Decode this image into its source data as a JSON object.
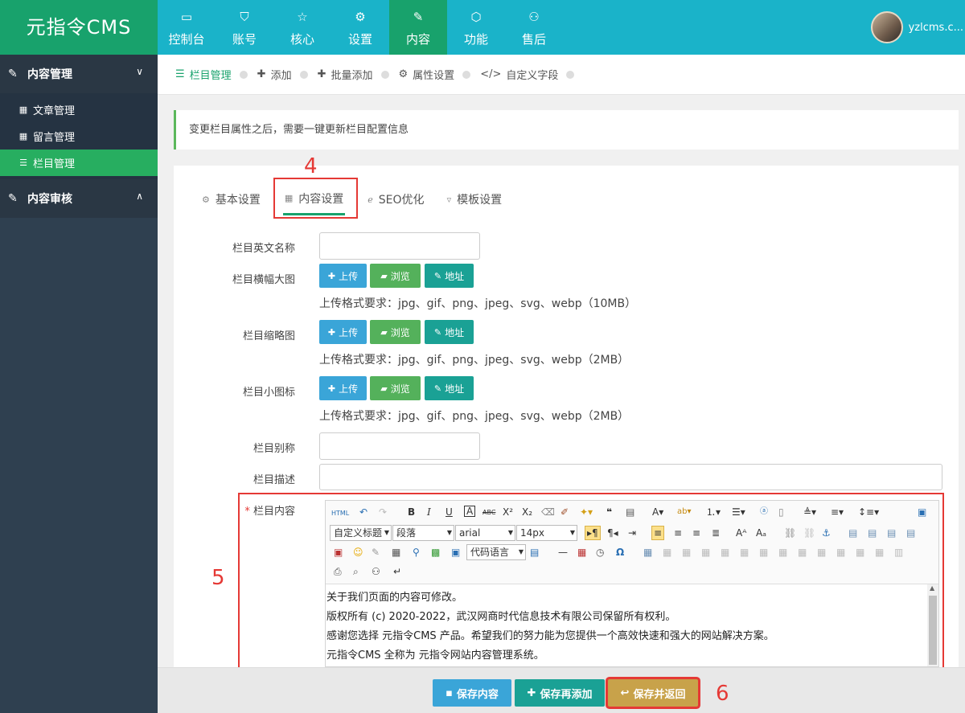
{
  "app": {
    "logo": "元指令CMS"
  },
  "nav": [
    {
      "label": "控制台",
      "icon": "monitor-icon",
      "glyph": "▭"
    },
    {
      "label": "账号",
      "icon": "shield-icon",
      "glyph": "⛉"
    },
    {
      "label": "核心",
      "icon": "star-icon",
      "glyph": "☆"
    },
    {
      "label": "设置",
      "icon": "gear-icon",
      "glyph": "⚙"
    },
    {
      "label": "内容",
      "icon": "edit-icon",
      "glyph": "✎"
    },
    {
      "label": "功能",
      "icon": "cube-icon",
      "glyph": "⬡"
    },
    {
      "label": "售后",
      "icon": "user-plus-icon",
      "glyph": "⚇"
    }
  ],
  "user": {
    "name": "yzlcms.c..."
  },
  "sidebar": {
    "section1": {
      "label": "内容管理",
      "chevron": "∨"
    },
    "items": [
      {
        "label": "文章管理",
        "glyph": "▦"
      },
      {
        "label": "留言管理",
        "glyph": "▦"
      },
      {
        "label": "栏目管理",
        "glyph": "☰"
      }
    ],
    "section2": {
      "label": "内容审核",
      "chevron": "∧"
    }
  },
  "crumbs": [
    {
      "label": "栏目管理",
      "glyph": "☰"
    },
    {
      "label": "添加",
      "glyph": "✚"
    },
    {
      "label": "批量添加",
      "glyph": "✚"
    },
    {
      "label": "属性设置",
      "glyph": "⚙"
    },
    {
      "label": "自定义字段",
      "glyph": "</>"
    }
  ],
  "notice": "变更栏目属性之后，需要一键更新栏目配置信息",
  "tabs": [
    {
      "label": "基本设置",
      "glyph": "⚙"
    },
    {
      "label": "内容设置",
      "glyph": "▦"
    },
    {
      "label": "SEO优化",
      "glyph": "ℯ"
    },
    {
      "label": "模板设置",
      "glyph": "▿"
    }
  ],
  "steps": {
    "s4": "4",
    "s5": "5",
    "s6": "6"
  },
  "form": {
    "en_name": "栏目英文名称",
    "banner": "栏目横幅大图",
    "thumb": "栏目缩略图",
    "icon": "栏目小图标",
    "alias": "栏目别称",
    "desc": "栏目描述",
    "content": "栏目内容",
    "required": "*",
    "upload": "上传",
    "browse": "浏览",
    "address": "地址",
    "hint_10mb": "上传格式要求：jpg、gif、png、jpeg、svg、webp（10MB）",
    "hint_2mb": "上传格式要求：jpg、gif、png、jpeg、svg、webp（2MB）"
  },
  "editor": {
    "html": "HTML",
    "heading": "自定义标题",
    "paragraph": "段落",
    "font": "arial",
    "size": "14px",
    "code_lang": "代码语言",
    "lines": [
      "关于我们页面的内容可修改。",
      "版权所有 (c) 2020-2022，武汉网商时代信息技术有限公司保留所有权利。",
      "感谢您选择 元指令CMS 产品。希望我们的努力能为您提供一个高效快速和强大的网站解决方案。",
      "元指令CMS 全称为 元指令网站内容管理系统。"
    ]
  },
  "footer": {
    "save": "保存内容",
    "save_add": "保存再添加",
    "save_back": "保存并返回"
  },
  "colors": {
    "primary": "#1ab3c9",
    "accent": "#18a26c",
    "highlight": "#e53935"
  }
}
